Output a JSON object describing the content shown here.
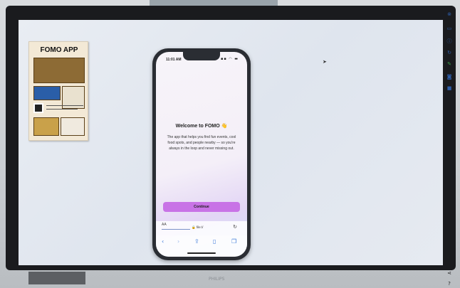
{
  "poster": {
    "title": "FOMO APP"
  },
  "phone": {
    "status_time": "11:01 AM",
    "status_icons": "▪▪ ◠ ▬",
    "welcome_title": "Welcome to FOMO",
    "wave_emoji": "👋",
    "description": "The app that helps you find fun events, cool food spots, and people nearby — so you're always in the loop and never missing out.",
    "continue_label": "Continue",
    "address_bar": {
      "aa_label": "AA",
      "url": "🔒 file://",
      "reload_icon": "reload-icon"
    },
    "toolbar": [
      "back-icon",
      "forward-icon",
      "share-icon",
      "bookmarks-icon",
      "tabs-icon"
    ]
  },
  "side_panel": {
    "icons": [
      "close-icon",
      "cast-icon",
      "info-icon",
      "refresh-icon",
      "pen-icon",
      "camera-icon",
      "video-icon",
      "moon-icon",
      "share-icon",
      "help-icon"
    ]
  },
  "monitor": {
    "brand": "PHILIPS"
  },
  "colors": {
    "continue_button": "#c873e6",
    "link_blue": "#3a78d8",
    "side_icon_blue": "#2f5ea8"
  }
}
